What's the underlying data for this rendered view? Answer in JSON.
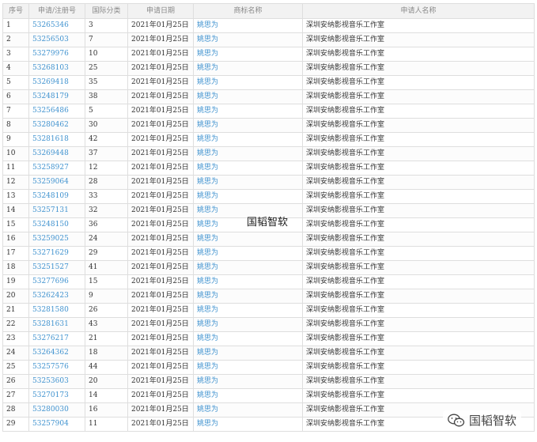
{
  "columns": [
    "序号",
    "申请/注册号",
    "国际分类",
    "申请日期",
    "商标名称",
    "申请人名称"
  ],
  "rows": [
    [
      "1",
      "53265346",
      "3",
      "2021年01月25日",
      "姚思为",
      "深圳安纳影视音乐工作室"
    ],
    [
      "2",
      "53256503",
      "7",
      "2021年01月25日",
      "姚思为",
      "深圳安纳影视音乐工作室"
    ],
    [
      "3",
      "53279976",
      "10",
      "2021年01月25日",
      "姚思为",
      "深圳安纳影视音乐工作室"
    ],
    [
      "4",
      "53268103",
      "25",
      "2021年01月25日",
      "姚思为",
      "深圳安纳影视音乐工作室"
    ],
    [
      "5",
      "53269418",
      "35",
      "2021年01月25日",
      "姚思为",
      "深圳安纳影视音乐工作室"
    ],
    [
      "6",
      "53248179",
      "38",
      "2021年01月25日",
      "姚思为",
      "深圳安纳影视音乐工作室"
    ],
    [
      "7",
      "53256486",
      "5",
      "2021年01月25日",
      "姚思为",
      "深圳安纳影视音乐工作室"
    ],
    [
      "8",
      "53280462",
      "30",
      "2021年01月25日",
      "姚思为",
      "深圳安纳影视音乐工作室"
    ],
    [
      "9",
      "53281618",
      "42",
      "2021年01月25日",
      "姚思为",
      "深圳安纳影视音乐工作室"
    ],
    [
      "10",
      "53269448",
      "37",
      "2021年01月25日",
      "姚思为",
      "深圳安纳影视音乐工作室"
    ],
    [
      "11",
      "53258927",
      "12",
      "2021年01月25日",
      "姚思为",
      "深圳安纳影视音乐工作室"
    ],
    [
      "12",
      "53259064",
      "28",
      "2021年01月25日",
      "姚思为",
      "深圳安纳影视音乐工作室"
    ],
    [
      "13",
      "53248109",
      "33",
      "2021年01月25日",
      "姚思为",
      "深圳安纳影视音乐工作室"
    ],
    [
      "14",
      "53257131",
      "32",
      "2021年01月25日",
      "姚思为",
      "深圳安纳影视音乐工作室"
    ],
    [
      "15",
      "53248150",
      "36",
      "2021年01月25日",
      "姚思为",
      "深圳安纳影视音乐工作室"
    ],
    [
      "16",
      "53259025",
      "24",
      "2021年01月25日",
      "姚思为",
      "深圳安纳影视音乐工作室"
    ],
    [
      "17",
      "53271629",
      "29",
      "2021年01月25日",
      "姚思为",
      "深圳安纳影视音乐工作室"
    ],
    [
      "18",
      "53251527",
      "41",
      "2021年01月25日",
      "姚思为",
      "深圳安纳影视音乐工作室"
    ],
    [
      "19",
      "53277696",
      "15",
      "2021年01月25日",
      "姚思为",
      "深圳安纳影视音乐工作室"
    ],
    [
      "20",
      "53262423",
      "9",
      "2021年01月25日",
      "姚思为",
      "深圳安纳影视音乐工作室"
    ],
    [
      "21",
      "53281580",
      "26",
      "2021年01月25日",
      "姚思为",
      "深圳安纳影视音乐工作室"
    ],
    [
      "22",
      "53281631",
      "43",
      "2021年01月25日",
      "姚思为",
      "深圳安纳影视音乐工作室"
    ],
    [
      "23",
      "53276217",
      "21",
      "2021年01月25日",
      "姚思为",
      "深圳安纳影视音乐工作室"
    ],
    [
      "24",
      "53264362",
      "18",
      "2021年01月25日",
      "姚思为",
      "深圳安纳影视音乐工作室"
    ],
    [
      "25",
      "53257576",
      "44",
      "2021年01月25日",
      "姚思为",
      "深圳安纳影视音乐工作室"
    ],
    [
      "26",
      "53253603",
      "20",
      "2021年01月25日",
      "姚思为",
      "深圳安纳影视音乐工作室"
    ],
    [
      "27",
      "53270173",
      "14",
      "2021年01月25日",
      "姚思为",
      "深圳安纳影视音乐工作室"
    ],
    [
      "28",
      "53280030",
      "16",
      "2021年01月25日",
      "姚思为",
      "深圳安纳影视音乐工作室"
    ],
    [
      "29",
      "53257904",
      "11",
      "2021年01月25日",
      "姚思为",
      "深圳安纳影视音乐工作室"
    ]
  ],
  "watermark_center": "国韬智软",
  "watermark_corner": "国韬智软",
  "watermark_icon": "wechat-icon",
  "colors": {
    "link": "#3f92cf",
    "header_bg": "#f2f2f2",
    "border": "#dedede"
  }
}
